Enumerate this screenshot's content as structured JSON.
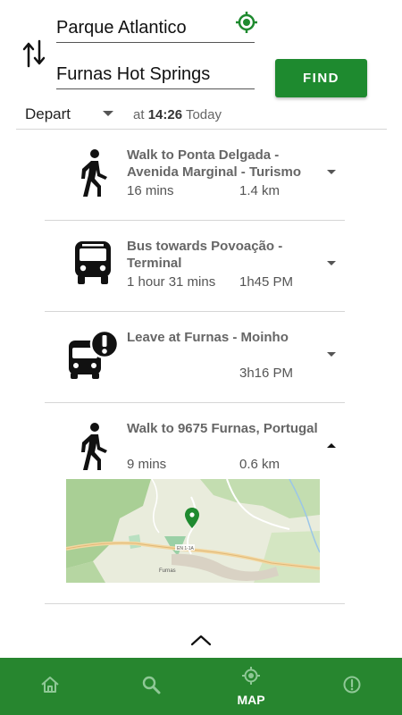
{
  "search": {
    "from_value": "Parque Atlantico",
    "to_value": "Furnas Hot Springs",
    "find_label": "FIND"
  },
  "time": {
    "mode": "Depart",
    "prefix": "at",
    "time": "14:26",
    "day": "Today"
  },
  "steps": [
    {
      "icon": "walk-icon",
      "title": "Walk to Ponta Delgada - Avenida Marginal - Turismo",
      "duration": "16 mins",
      "detail": "1.4 km",
      "expanded": false
    },
    {
      "icon": "bus-icon",
      "title": "Bus towards Povoação - Terminal",
      "duration": "1 hour 31 mins",
      "detail": "1h45 PM",
      "expanded": false
    },
    {
      "icon": "bus-alert-icon",
      "title": "Leave at Furnas - Moinho",
      "duration": "",
      "detail": "3h16 PM",
      "expanded": false
    },
    {
      "icon": "walk-icon",
      "title": "Walk to 9675 Furnas, Portugal",
      "duration": "9 mins",
      "detail": "0.6 km",
      "expanded": true
    }
  ],
  "map": {
    "road_label": "EN 1-1A",
    "place_label": "Furnas"
  },
  "bottom_nav": {
    "items": [
      {
        "icon": "home-icon",
        "label": ""
      },
      {
        "icon": "search-icon",
        "label": ""
      },
      {
        "icon": "map-locate-icon",
        "label": "MAP",
        "active": true
      },
      {
        "icon": "info-icon",
        "label": ""
      }
    ]
  },
  "colors": {
    "primary_green": "#1e8a2f",
    "nav_green": "#27862f",
    "inactive_icon": "#8fc896"
  }
}
